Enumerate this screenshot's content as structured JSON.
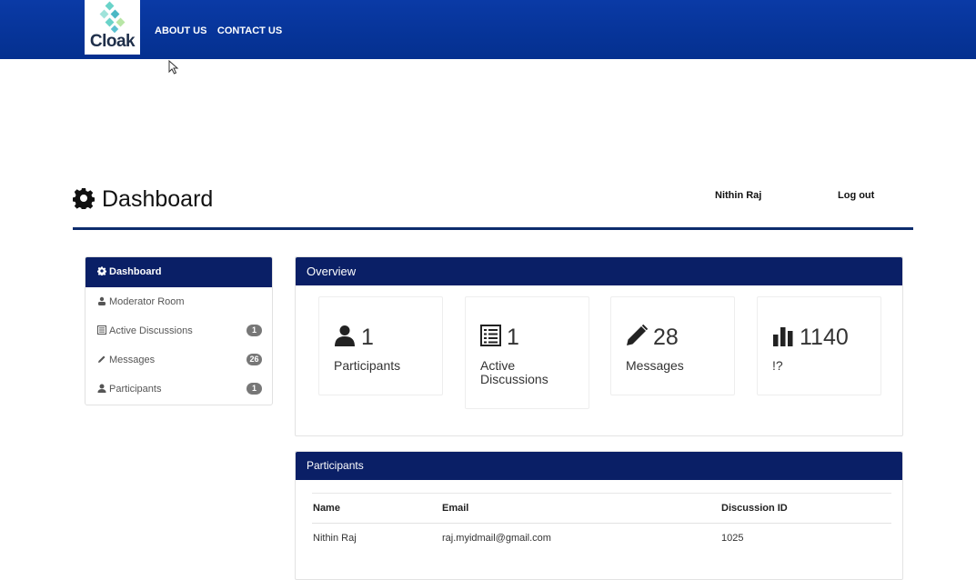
{
  "brand": {
    "logo_text": "Cloak"
  },
  "topnav": {
    "about": "ABOUT US",
    "contact": "CONTACT US"
  },
  "header": {
    "title": "Dashboard",
    "user": "Nithin Raj",
    "logout": "Log out"
  },
  "sidebar": {
    "items": [
      {
        "label": "Dashboard",
        "icon": "gear-icon"
      },
      {
        "label": "Moderator Room",
        "icon": "users-icon"
      },
      {
        "label": "Active Discussions",
        "icon": "list-icon",
        "badge": "1"
      },
      {
        "label": "Messages",
        "icon": "pencil-icon",
        "badge": "26"
      },
      {
        "label": "Participants",
        "icon": "user-icon",
        "badge": "1"
      }
    ]
  },
  "overview": {
    "title": "Overview",
    "cards": [
      {
        "value": "1",
        "label": "Participants",
        "icon": "user-icon"
      },
      {
        "value": "1",
        "label": "Active Discussions",
        "icon": "list-icon"
      },
      {
        "value": "28",
        "label": "Messages",
        "icon": "pencil-icon"
      },
      {
        "value": "1140",
        "label": "!?",
        "icon": "bar-chart-icon"
      }
    ]
  },
  "participants": {
    "title": "Participants",
    "columns": [
      "Name",
      "Email",
      "Discussion ID"
    ],
    "rows": [
      [
        "Nithin Raj",
        "raj.myidmail@gmail.com",
        "1025"
      ]
    ]
  },
  "colors": {
    "topbar": "#04308f",
    "panel_header": "#0a1f66",
    "badge": "#777777"
  }
}
